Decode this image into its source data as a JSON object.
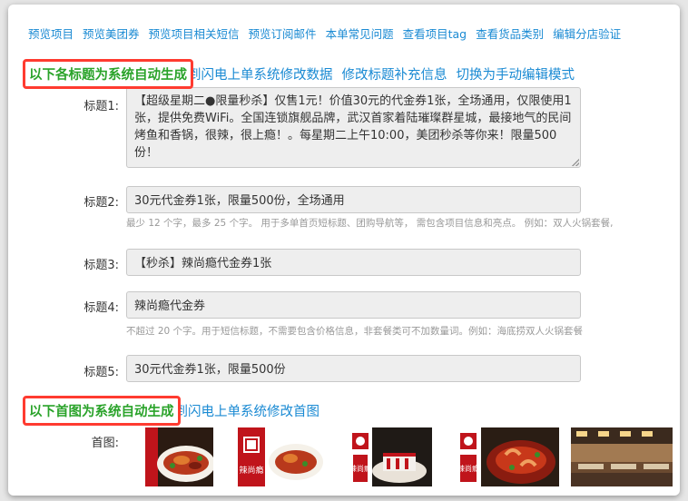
{
  "nav_links": [
    "预览项目",
    "预览美团券",
    "预览项目相关短信",
    "预览订阅邮件",
    "本单常见问题",
    "查看项目tag",
    "查看货品类别",
    "编辑分店验证"
  ],
  "titles_section": {
    "highlight": "以下各标题为系统自动生成",
    "partial": "到闪电上单系统修改数据",
    "link1": "修改标题补充信息",
    "link2": "切换为手动编辑模式"
  },
  "fields": {
    "t1_label": "标题1:",
    "t1_value": "【超级星期二●限量秒杀】仅售1元！价值30元的代金券1张，全场通用，仅限使用1张，提供免费WiFi。全国连锁旗舰品牌，武汉首家着陆璀璨群星城，最接地气的民间烤鱼和香锅，很辣，很上瘾！。每星期二上午10:00，美团秒杀等你来！限量500份！",
    "t2_label": "标题2:",
    "t2_value": "30元代金券1张，限量500份，全场通用",
    "t2_hint": "最少 12 个字，最多 25 个字。 用于多单首页短标题、团购导航等， 需包含项目信息和亮点。 例如：双人火锅套餐,",
    "t3_label": "标题3:",
    "t3_value": "【秒杀】辣尚瘾代金券1张",
    "t4_label": "标题4:",
    "t4_value": "辣尚瘾代金券",
    "t4_hint": "不超过 20 个字。用于短信标题，不需要包含价格信息，非套餐类可不加数量词。例如：海底捞双人火锅套餐",
    "t5_label": "标题5:",
    "t5_value": "30元代金券1张，限量500份"
  },
  "image_section": {
    "highlight": "以下首图为系统自动生成",
    "partial": "到闪电上单系统修改首图",
    "label": "首图:"
  },
  "images": [
    {
      "name": "fish-dish-image",
      "logo": false
    },
    {
      "name": "logo-fish-image",
      "logo": true,
      "logo_text": "辣尚瘾"
    },
    {
      "name": "logo-dessert-image",
      "logo": true,
      "logo_text": "辣尚瘾"
    },
    {
      "name": "logo-shrimp-image",
      "logo": true,
      "logo_text": "辣尚瘾"
    },
    {
      "name": "restaurant-interior-image",
      "logo": false
    }
  ],
  "colors": {
    "link": "#1a8ad3",
    "green": "#2aa32a",
    "red_border": "#ff3b30"
  }
}
